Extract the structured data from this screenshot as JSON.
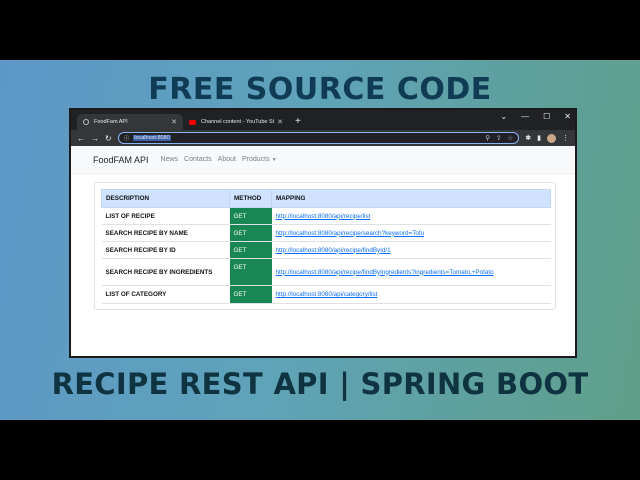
{
  "thumbnail": {
    "headline_top": "FREE SOURCE CODE",
    "headline_bottom": "RECIPE REST API | SPRING BOOT"
  },
  "browser": {
    "tabs": [
      {
        "label": "FoodFam API",
        "icon": "globe-icon",
        "active": true
      },
      {
        "label": "Channel content - YouTube Studio",
        "icon": "youtube-icon",
        "active": false
      }
    ],
    "new_tab": "+",
    "controls": {
      "collapse": "⌄",
      "minimize": "—",
      "maximize": "☐",
      "close": "✕"
    },
    "url": "localhost:8080"
  },
  "page": {
    "brand": "FoodFAM API",
    "nav": [
      "News",
      "Contacts",
      "About",
      "Products"
    ],
    "table": {
      "headers": [
        "DESCRIPTION",
        "METHOD",
        "MAPPING"
      ],
      "rows": [
        {
          "description": "LIST OF RECIPE",
          "method": "GET",
          "mapping": "http://localhost:8080/api/recipe/list"
        },
        {
          "description": "SEARCH RECIPE BY NAME",
          "method": "GET",
          "mapping": "http://localhost:8080/api/recipe/search?keyword=Tofu"
        },
        {
          "description": "SEARCH RECIPE BY ID",
          "method": "GET",
          "mapping": "http://localhost:8080/api/recipe/findById/1"
        },
        {
          "description": "SEARCH RECIPE BY INGREDIENTS",
          "method": "GET",
          "mapping": "http://localhost:8080/api/recipe/findByIngredients?ingredients=Tomato,+Potato"
        },
        {
          "description": "LIST OF CATEGORY",
          "method": "GET",
          "mapping": "http://localhost:8080/api/category/list"
        }
      ]
    }
  },
  "colors": {
    "method_badge": "#198754",
    "table_header": "#cfe2ff",
    "link": "#0d6efd",
    "headline": "#0f3b55"
  }
}
